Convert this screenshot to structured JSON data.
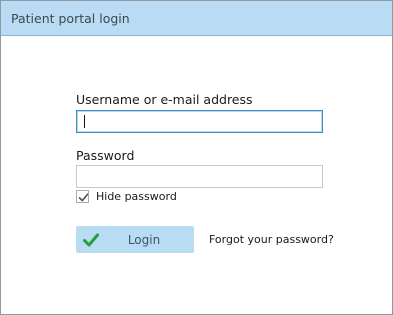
{
  "window": {
    "title": "Patient portal login"
  },
  "form": {
    "username_label": "Username or e-mail address",
    "username_value": "",
    "password_label": "Password",
    "password_value": "",
    "hide_password_label": "Hide password",
    "hide_password_checked": true,
    "login_label": "Login",
    "forgot_password_label": "Forgot your password?"
  },
  "colors": {
    "titlebar_bg": "#b9dcf4",
    "button_bg": "#b8dcf3",
    "check_icon": "#2a9d3c",
    "focus_border": "#3d8ec4"
  },
  "icons": {
    "login_button_icon": "check-icon",
    "checkbox_mark": "checkmark-icon"
  }
}
